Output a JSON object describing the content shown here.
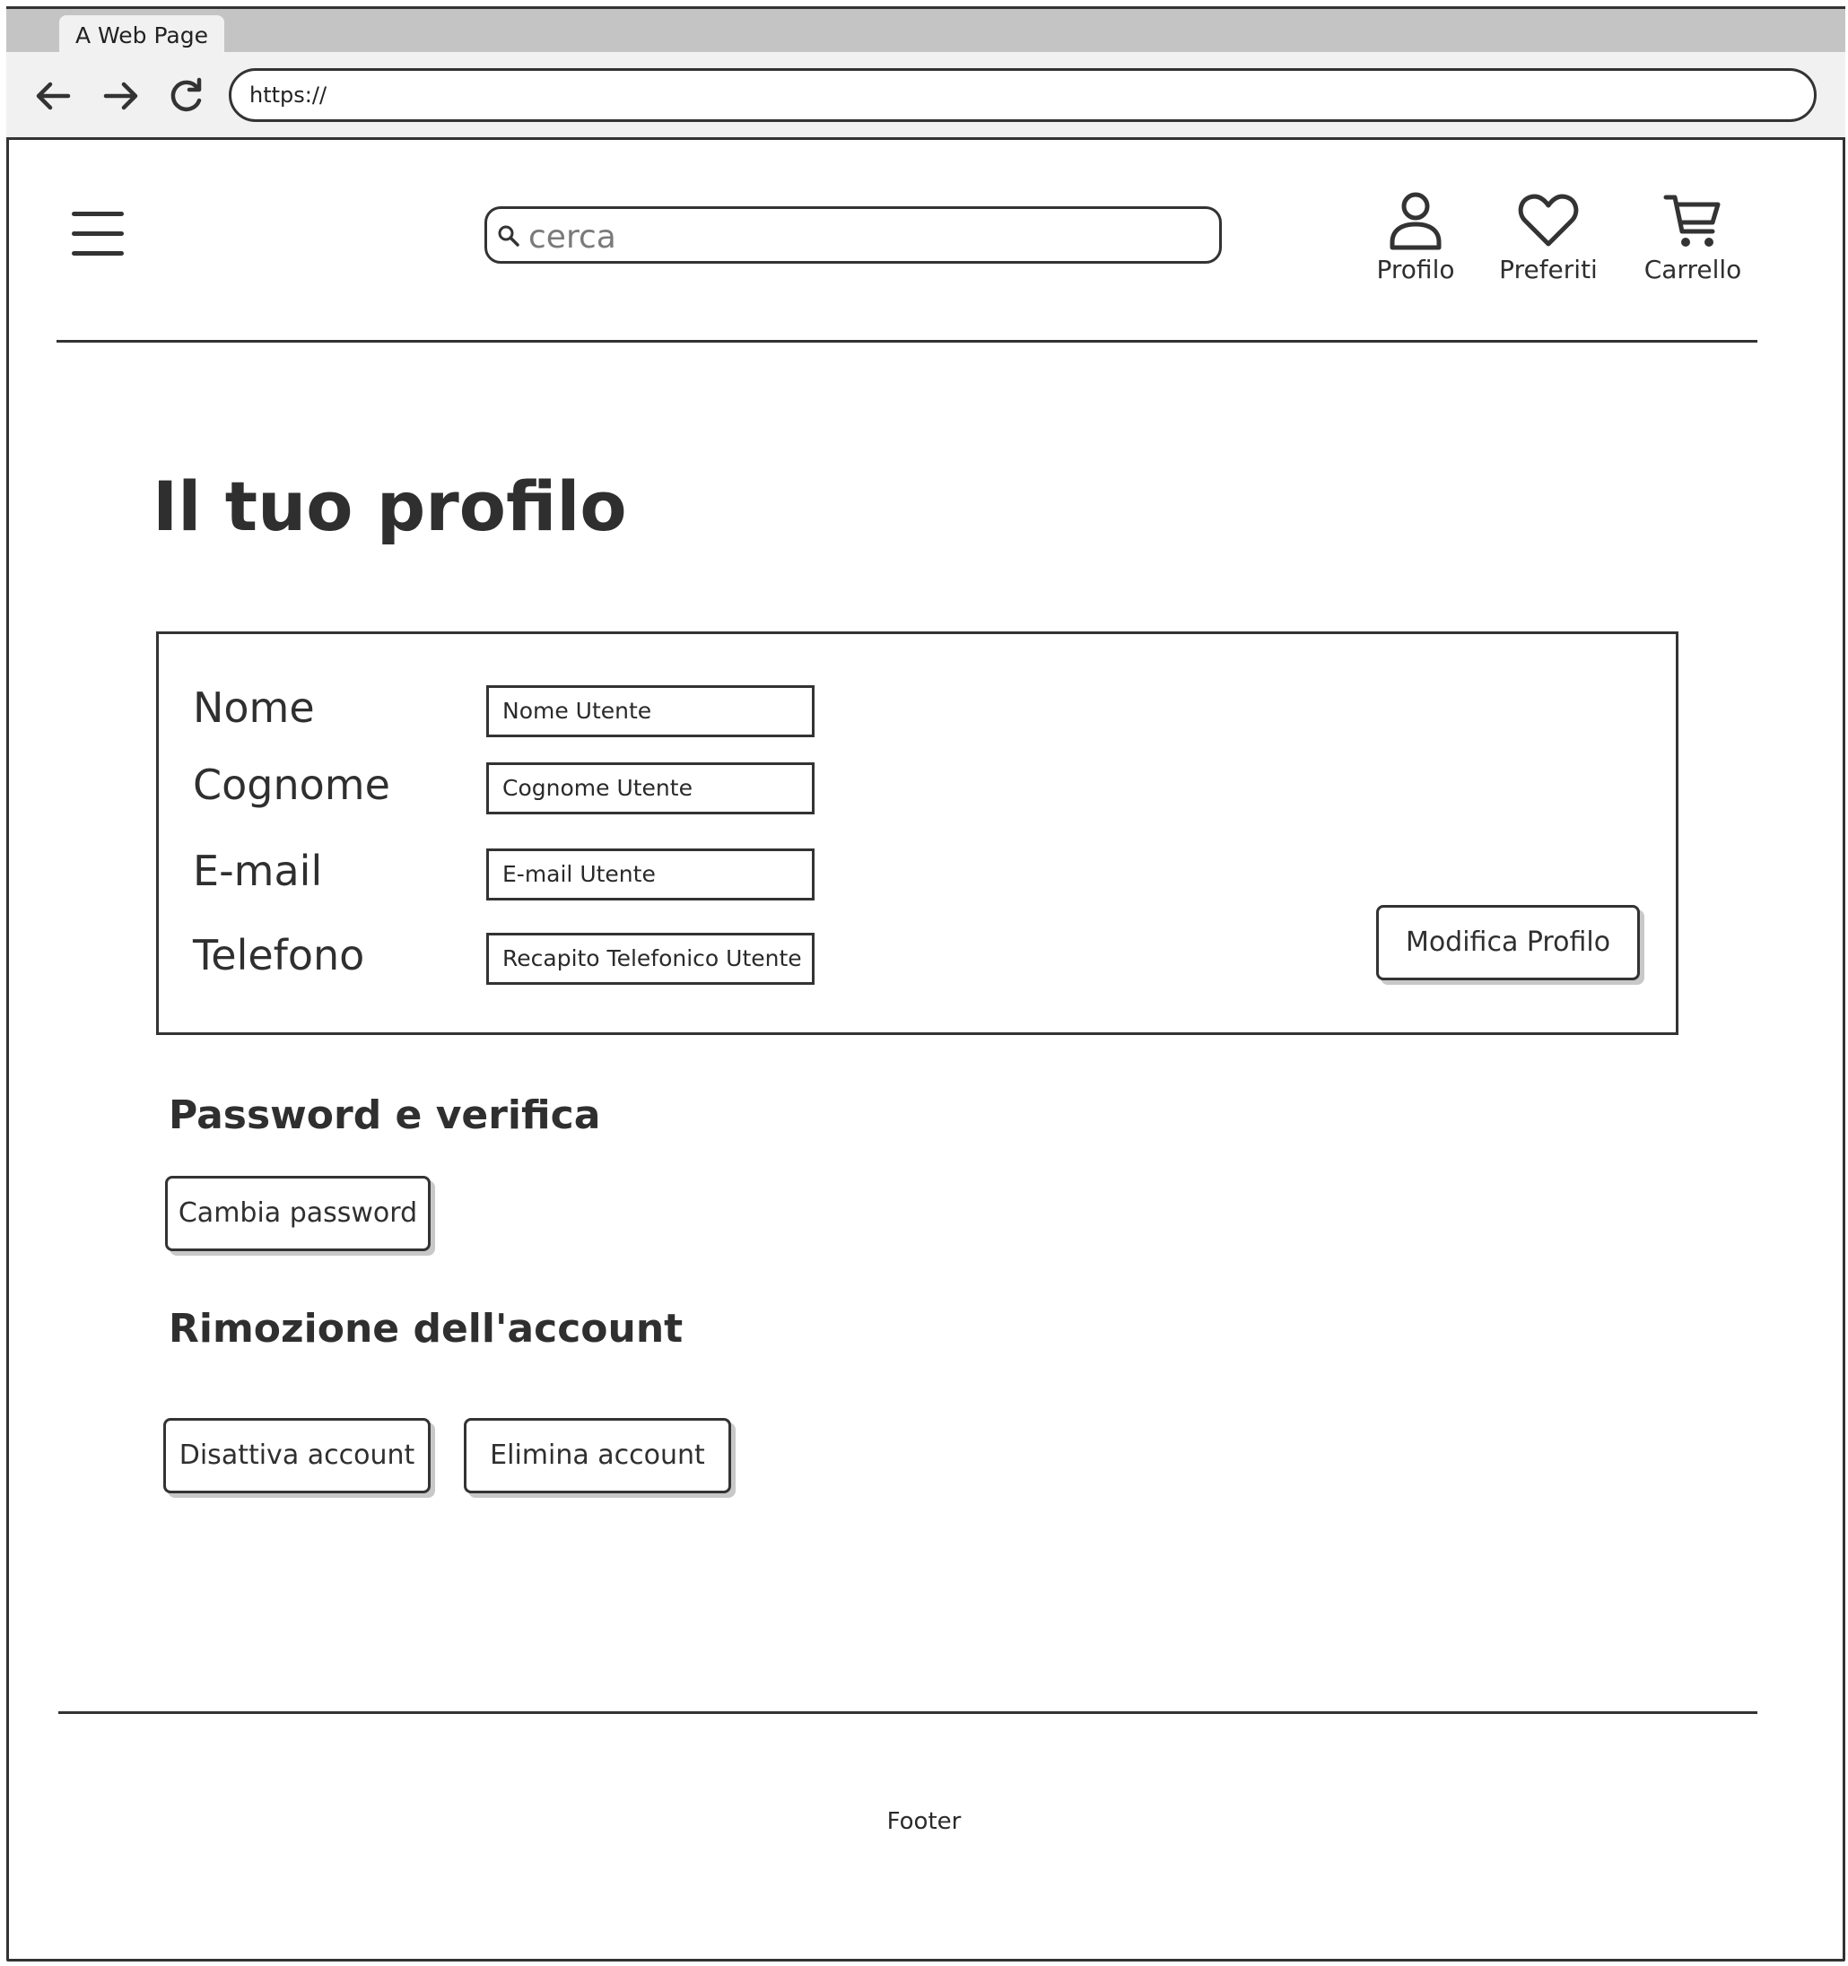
{
  "browser": {
    "tab_title": "A Web Page",
    "url": "https://",
    "back_icon": "arrow-left-icon",
    "forward_icon": "arrow-right-icon",
    "reload_icon": "reload-icon"
  },
  "header": {
    "menu_icon": "hamburger-menu-icon",
    "search": {
      "placeholder": "cerca",
      "icon": "search-icon"
    },
    "actions": [
      {
        "label": "Profilo",
        "icon": "user-icon"
      },
      {
        "label": "Preferiti",
        "icon": "heart-icon"
      },
      {
        "label": "Carrello",
        "icon": "cart-icon"
      }
    ]
  },
  "main": {
    "title": "Il tuo profilo",
    "profile_fields": [
      {
        "label": "Nome",
        "value": "Nome Utente"
      },
      {
        "label": "Cognome",
        "value": "Cognome Utente"
      },
      {
        "label": "E-mail",
        "value": "E-mail Utente"
      },
      {
        "label": "Telefono",
        "value": "Recapito Telefonico Utente"
      }
    ],
    "edit_button": "Modifica Profilo",
    "password_section": {
      "title": "Password e verifica",
      "button": "Cambia password"
    },
    "removal_section": {
      "title": "Rimozione dell'account",
      "deactivate_button": "Disattiva account",
      "delete_button": "Elimina account"
    }
  },
  "footer": {
    "text": "Footer"
  }
}
